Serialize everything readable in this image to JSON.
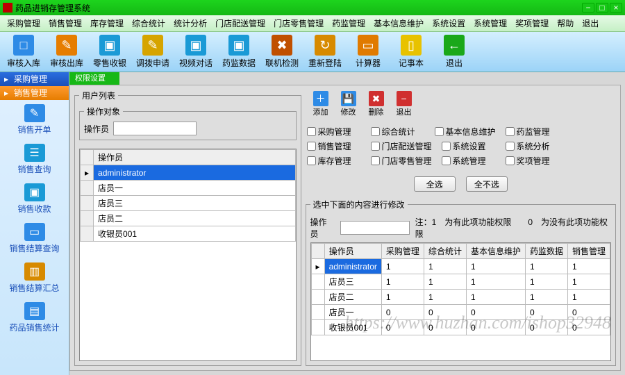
{
  "window": {
    "title": "药品进销存管理系统"
  },
  "menu": [
    "采购管理",
    "销售管理",
    "库存管理",
    "综合统计",
    "统计分析",
    "门店配送管理",
    "门店零售管理",
    "药监管理",
    "基本信息维护",
    "系统设置",
    "系统管理",
    "奖项管理",
    "帮助",
    "退出"
  ],
  "toolbar": [
    {
      "label": "审核入库",
      "color": "#2e8be6",
      "glyph": "□"
    },
    {
      "label": "审核出库",
      "color": "#e67d00",
      "glyph": "✎"
    },
    {
      "label": "零售收银",
      "color": "#1a9ad6",
      "glyph": "▣"
    },
    {
      "label": "调拨申请",
      "color": "#d6a400",
      "glyph": "✎"
    },
    {
      "label": "视频对话",
      "color": "#1a9ad6",
      "glyph": "▣"
    },
    {
      "label": "药监数据",
      "color": "#1a9ad6",
      "glyph": "▣"
    },
    {
      "label": "联机检测",
      "color": "#c05000",
      "glyph": "✖"
    },
    {
      "label": "重新登陆",
      "color": "#d78a00",
      "glyph": "↻"
    },
    {
      "label": "计算器",
      "color": "#e07a00",
      "glyph": "▭"
    },
    {
      "label": "记事本",
      "color": "#e8c200",
      "glyph": "▯"
    },
    {
      "label": "退出",
      "color": "#1aa81a",
      "glyph": "←"
    }
  ],
  "nav": {
    "purchase_header": "采购管理",
    "sales_header": "销售管理",
    "items": [
      {
        "label": "销售开单",
        "color": "#2e8be6",
        "glyph": "✎"
      },
      {
        "label": "销售查询",
        "color": "#1a9ad6",
        "glyph": "☰"
      },
      {
        "label": "销售收款",
        "color": "#1a9ad6",
        "glyph": "▣"
      },
      {
        "label": "销售结算查询",
        "color": "#2e8be6",
        "glyph": "▭"
      },
      {
        "label": "销售结算汇总",
        "color": "#d78a00",
        "glyph": "▥"
      },
      {
        "label": "药品销售统计",
        "color": "#2e8be6",
        "glyph": "▤"
      }
    ]
  },
  "panel": {
    "tab": "权限设置",
    "userlist_legend": "用户列表",
    "opsearch_legend": "操作对象",
    "operator_label": "操作员",
    "operator_value": "",
    "list_header": "操作员",
    "list": [
      "administrator",
      "店员一",
      "店员三",
      "店员二",
      "收银员001"
    ],
    "actions": [
      {
        "label": "添加",
        "glyph": "＋",
        "color": "#2e8be6"
      },
      {
        "label": "修改",
        "glyph": "💾",
        "color": "#2e8be6"
      },
      {
        "label": "删除",
        "glyph": "✖",
        "color": "#d03030"
      },
      {
        "label": "退出",
        "glyph": "−",
        "color": "#d03030"
      }
    ],
    "checks": [
      "采购管理",
      "综合统计",
      "基本信息维护",
      "药监管理",
      "销售管理",
      "门店配送管理",
      "系统设置",
      "系统分析",
      "库存管理",
      "门店零售管理",
      "系统管理",
      "奖项管理"
    ],
    "select_all": "全选",
    "select_none": "全不选",
    "edit_legend": "选中下面的内容进行修改",
    "hint_operator_label": "操作员",
    "hint_text": "注：1　为有此项功能权限　　0　为没有此项功能权限",
    "perm_columns": [
      "操作员",
      "采购管理",
      "综合统计",
      "基本信息维护",
      "药监数据",
      "销售管理"
    ],
    "perm_rows": [
      {
        "op": "administrator",
        "v": [
          1,
          1,
          1,
          1,
          1
        ]
      },
      {
        "op": "店员三",
        "v": [
          1,
          1,
          1,
          1,
          1
        ]
      },
      {
        "op": "店员二",
        "v": [
          1,
          1,
          1,
          1,
          1
        ]
      },
      {
        "op": "店员一",
        "v": [
          0,
          0,
          0,
          0,
          0
        ]
      },
      {
        "op": "收银员001",
        "v": [
          0,
          0,
          0,
          0,
          0
        ]
      }
    ]
  },
  "watermark": "https://www.huzhan.com/ishop32948"
}
